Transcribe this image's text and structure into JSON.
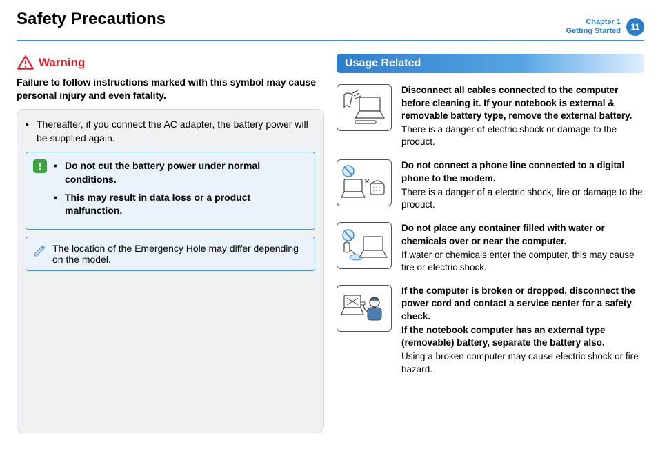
{
  "header": {
    "title": "Safety Precautions",
    "chapter_line1": "Chapter 1",
    "chapter_line2": "Getting Started",
    "page_number": "11"
  },
  "left": {
    "warning_label": "Warning",
    "warning_text": "Failure to follow instructions marked with this symbol may cause personal injury and even fatality.",
    "ac_bullet": "Thereafter, if you connect the AC adapter, the battery power will be supplied again.",
    "caution": {
      "b1": "Do not cut the battery power under normal conditions.",
      "b2": "This may result in data loss or a product malfunction."
    },
    "note": "The location of the Emergency Hole may differ depending on the model."
  },
  "right": {
    "section_title": "Usage Related",
    "items": [
      {
        "bold": "Disconnect all cables connected to the computer before cleaning it. If your notebook is external & removable battery type, remove the external battery.",
        "sub": "There is a danger of electric shock or damage to the product."
      },
      {
        "bold": "Do not connect a phone line connected to a digital phone to the modem.",
        "sub": "There is a danger of a electric shock, fire or damage to the product."
      },
      {
        "bold": "Do not place any container filled with water or chemicals over or near the computer.",
        "sub": "If water or chemicals enter the computer, this may cause fire or electric shock."
      },
      {
        "bold": "If the computer is broken or dropped, disconnect the power cord and contact a service center for a safety check.",
        "bold2": "If the notebook computer has an external type (removable) battery, separate the battery also.",
        "sub": "Using a broken computer may cause electric shock or fire hazard."
      }
    ]
  }
}
